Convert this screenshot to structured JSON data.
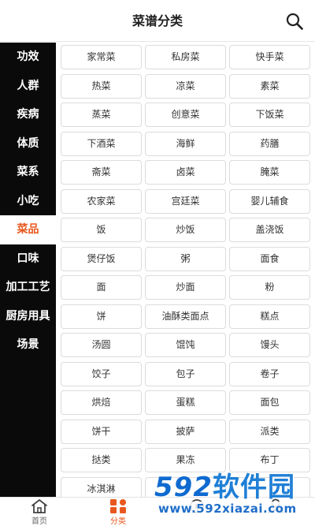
{
  "header": {
    "title": "菜谱分类",
    "search_icon": "search-icon"
  },
  "sidebar": {
    "items": [
      {
        "label": "功效",
        "active": false
      },
      {
        "label": "人群",
        "active": false
      },
      {
        "label": "疾病",
        "active": false
      },
      {
        "label": "体质",
        "active": false
      },
      {
        "label": "菜系",
        "active": false
      },
      {
        "label": "小吃",
        "active": false
      },
      {
        "label": "菜品",
        "active": true
      },
      {
        "label": "口味",
        "active": false
      },
      {
        "label": "加工工艺",
        "active": false
      },
      {
        "label": "厨房用具",
        "active": false
      },
      {
        "label": "场景",
        "active": false
      }
    ],
    "active_color": "#e8581e"
  },
  "grid": {
    "cells": [
      "家常菜",
      "私房菜",
      "快手菜",
      "热菜",
      "凉菜",
      "素菜",
      "蒸菜",
      "创意菜",
      "下饭菜",
      "下酒菜",
      "海鲜",
      "药膳",
      "斋菜",
      "卤菜",
      "腌菜",
      "农家菜",
      "宫廷菜",
      "婴儿辅食",
      "饭",
      "炒饭",
      "盖浇饭",
      "煲仔饭",
      "粥",
      "面食",
      "面",
      "炒面",
      "粉",
      "饼",
      "油酥类面点",
      "糕点",
      "汤圆",
      "馄饨",
      "馒头",
      "饺子",
      "包子",
      "卷子",
      "烘焙",
      "蛋糕",
      "面包",
      "饼干",
      "披萨",
      "派类",
      "挞类",
      "果冻",
      "布丁",
      "冰淇淋",
      "",
      ""
    ]
  },
  "tabbar": {
    "tabs": [
      {
        "label": "首页",
        "icon": "home-icon",
        "active": false
      },
      {
        "label": "分类",
        "icon": "category-icon",
        "active": true
      },
      {
        "label": "",
        "icon": "video-icon",
        "active": false
      },
      {
        "label": "",
        "icon": "profile-icon",
        "active": false
      }
    ]
  },
  "watermark": {
    "brand": "592软件园",
    "url": "www.592xiazai.com"
  }
}
